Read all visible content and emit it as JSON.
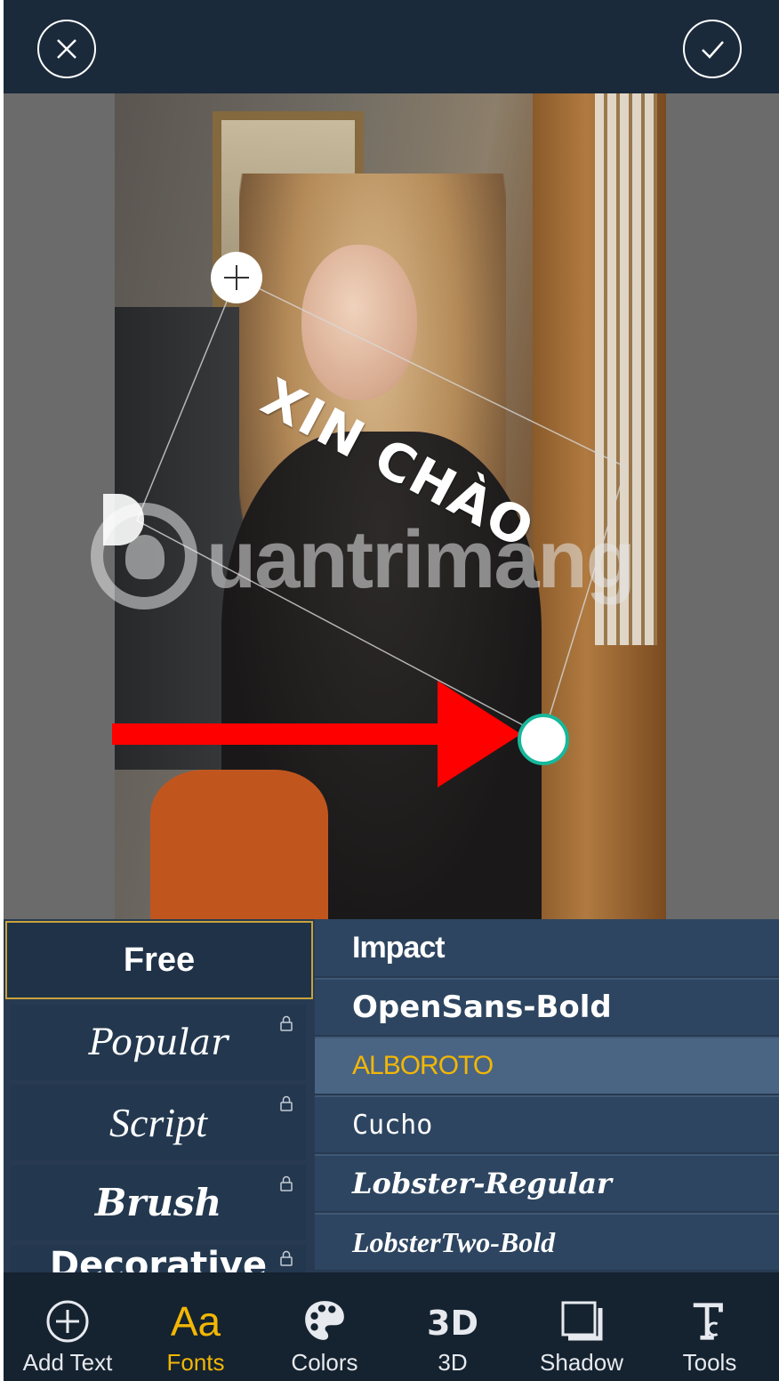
{
  "header": {
    "cancel_icon": "close-icon",
    "confirm_icon": "check-icon"
  },
  "canvas": {
    "overlay_text": "XIN CHÀO",
    "watermark": "uantrimang",
    "handles": [
      "add-icon",
      "resize-handle"
    ]
  },
  "font_picker": {
    "categories": [
      {
        "label": "Free",
        "locked": false,
        "selected": true
      },
      {
        "label": "Popular",
        "locked": true
      },
      {
        "label": "Script",
        "locked": true
      },
      {
        "label": "Brush",
        "locked": true
      },
      {
        "label": "Decorative",
        "locked": true
      }
    ],
    "fonts": [
      {
        "name": "Impact"
      },
      {
        "name": "OpenSans-Bold"
      },
      {
        "name": "ALBOROTO",
        "selected": true
      },
      {
        "name": "Cucho"
      },
      {
        "name": "Lobster-Regular"
      },
      {
        "name": "LobsterTwo-Bold"
      }
    ]
  },
  "toolbar": {
    "items": [
      {
        "label": "Add Text",
        "icon": "plus-circle-icon"
      },
      {
        "label": "Fonts",
        "icon": "Aa",
        "active": true
      },
      {
        "label": "Colors",
        "icon": "palette-icon"
      },
      {
        "label": "3D",
        "icon": "3D"
      },
      {
        "label": "Shadow",
        "icon": "shadow-square-icon"
      },
      {
        "label": "Tools",
        "icon": "text-tools-icon"
      }
    ]
  },
  "colors": {
    "accent": "#f2b705",
    "handle_ring": "#17b89a",
    "arrow": "#ff0000",
    "panel": "#273a51",
    "selected_row": "#4a6483"
  }
}
